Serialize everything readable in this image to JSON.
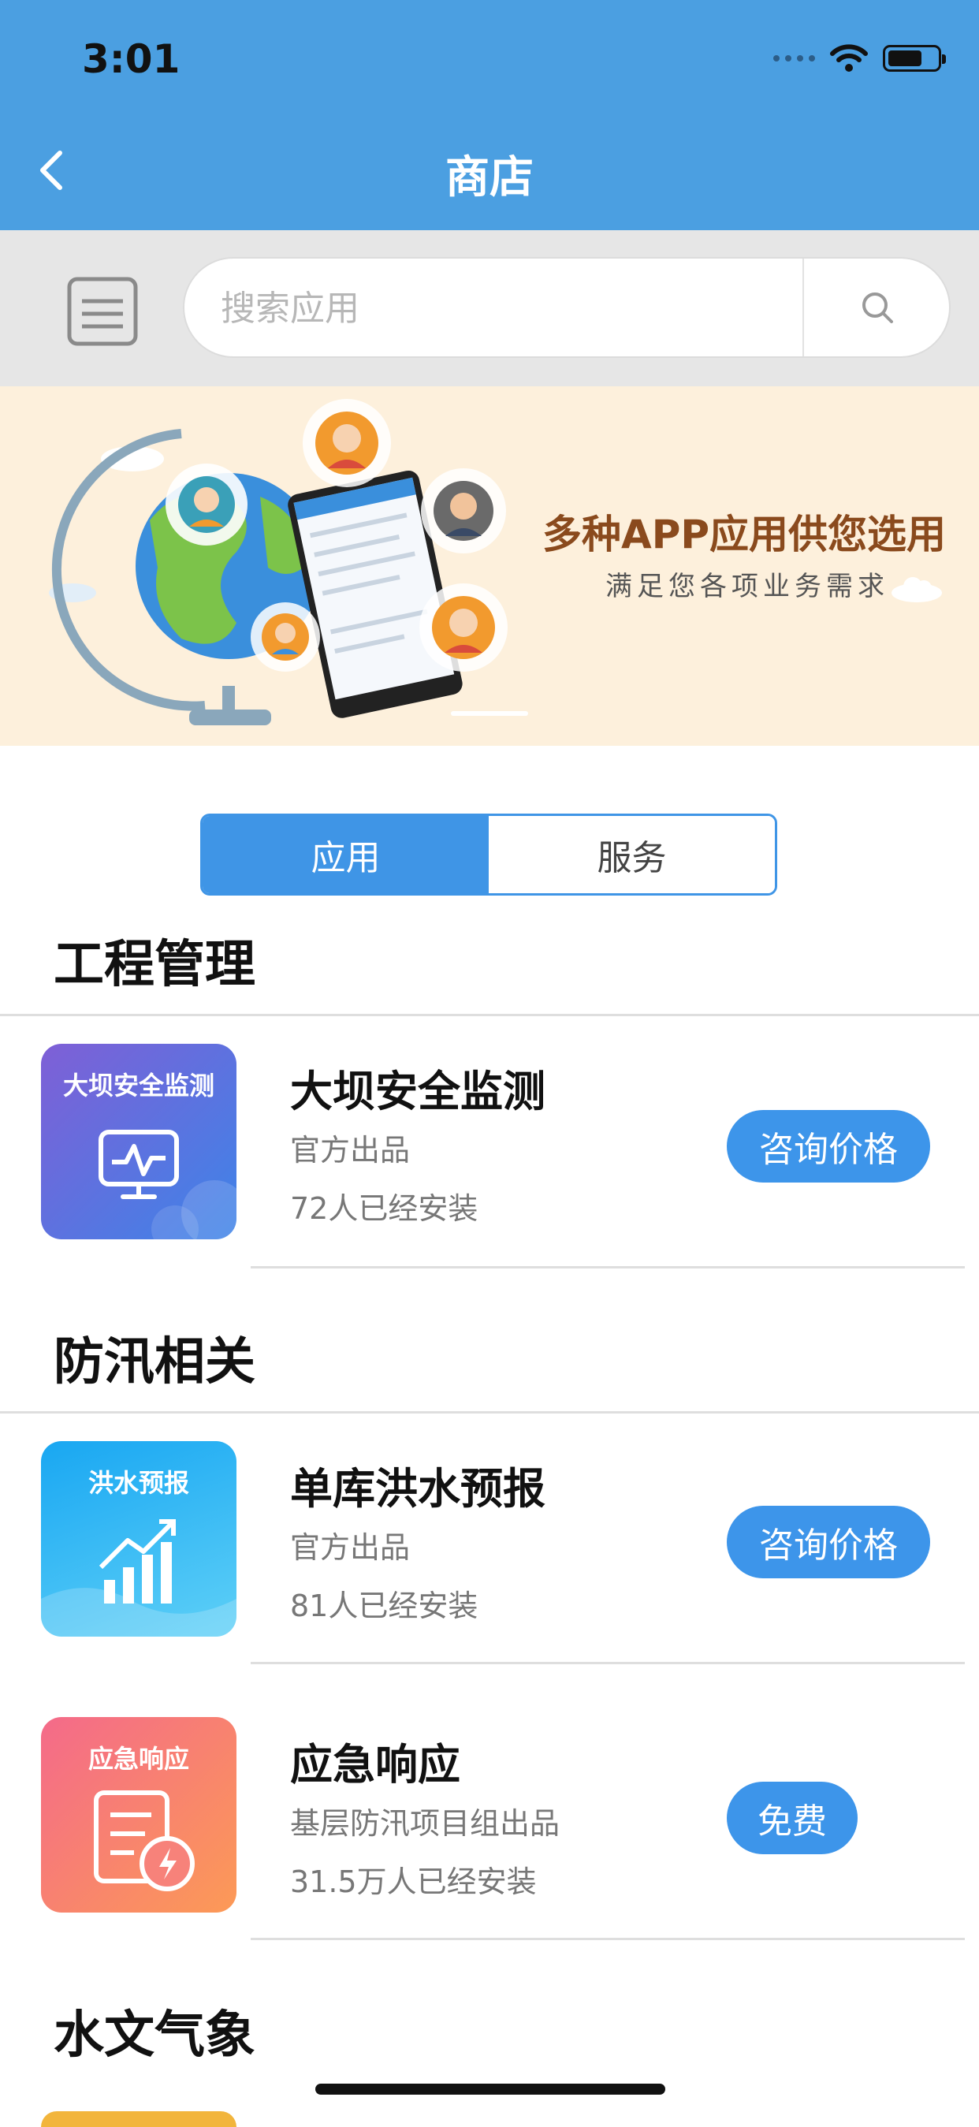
{
  "status_bar": {
    "time": "3:01",
    "battery_level": 0.7
  },
  "nav": {
    "title": "商店"
  },
  "search": {
    "placeholder": "搜索应用"
  },
  "banner": {
    "title": "多种APP应用供您选用",
    "subtitle": "满足您各项业务需求"
  },
  "segment": {
    "tabs": [
      "应用",
      "服务"
    ],
    "active": 0
  },
  "sections": [
    {
      "title": "工程管理",
      "apps": [
        {
          "icon_label": "大坝安全监测",
          "name": "大坝安全监测",
          "publisher": "官方出品",
          "installs": "72人已经安装",
          "action": "咨询价格"
        }
      ]
    },
    {
      "title": "防汛相关",
      "apps": [
        {
          "icon_label": "洪水预报",
          "name": "单库洪水预报",
          "publisher": "官方出品",
          "installs": "81人已经安装",
          "action": "咨询价格"
        },
        {
          "icon_label": "应急响应",
          "name": "应急响应",
          "publisher": "基层防汛项目组出品",
          "installs": "31.5万人已经安装",
          "action": "免费"
        }
      ]
    },
    {
      "title": "水文气象",
      "apps": []
    }
  ],
  "colors": {
    "nav_bg": "#4b9fe1",
    "accent": "#3d95ea",
    "banner_bg": "#fdf0dc"
  }
}
